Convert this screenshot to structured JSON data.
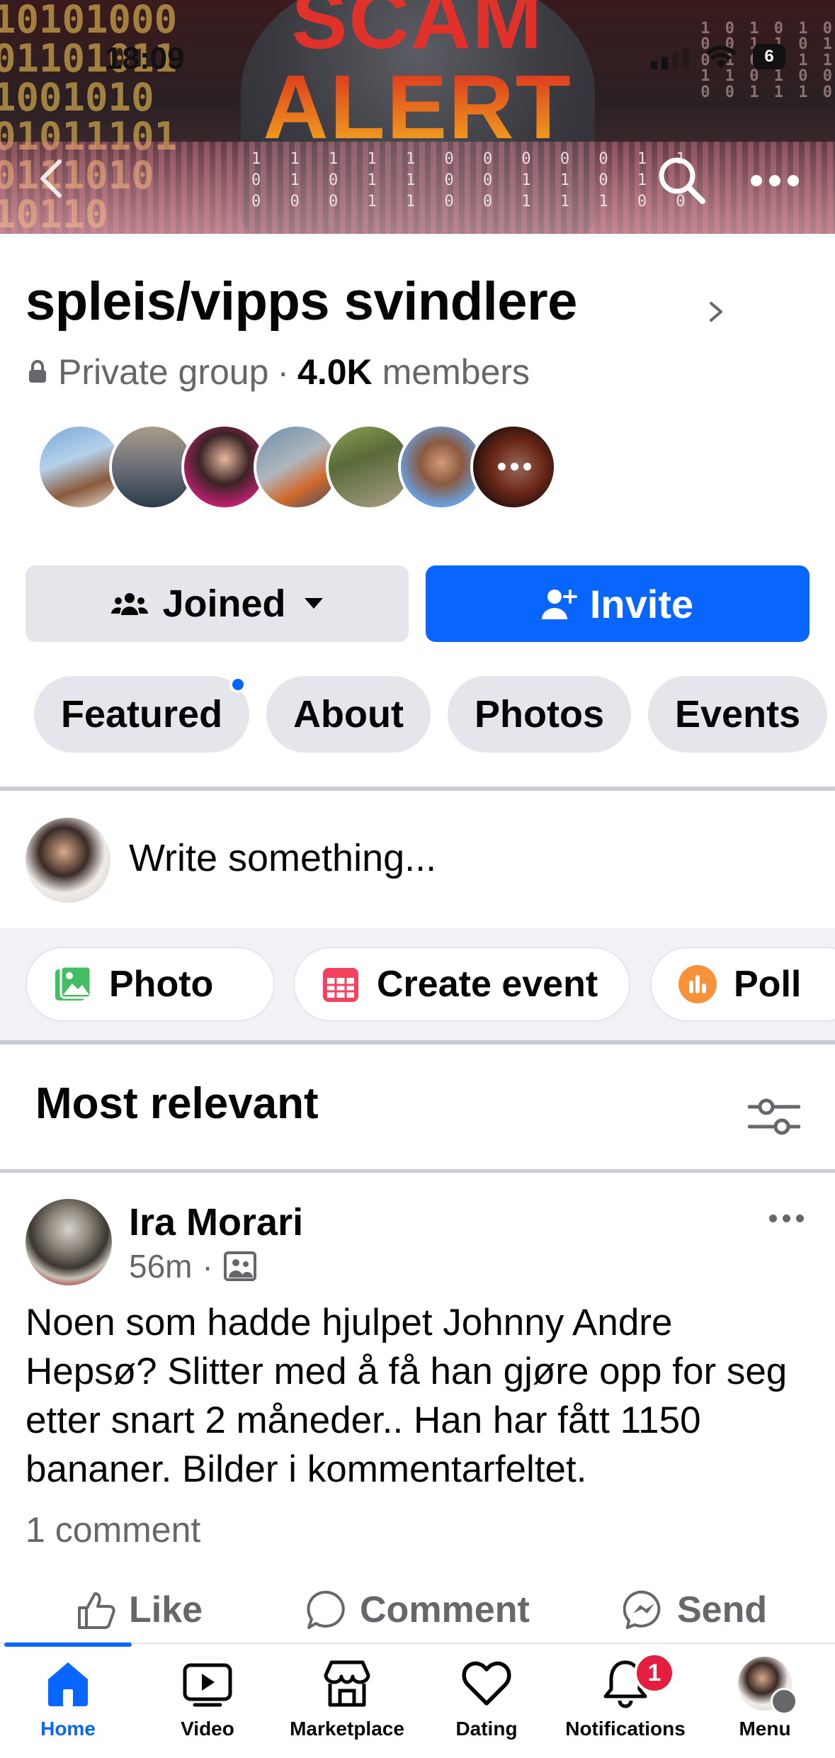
{
  "status_bar": {
    "time": "18:09",
    "battery": "6"
  },
  "cover": {
    "headline_top": "SCAM",
    "headline_bottom": "ALERT",
    "binary_left": "10101000\n01101011\n1001010\n01011101\n0111010\n10110",
    "binary_right": "1 0 1 0 1 0\n0 0 1 1 0 1\n0 1 0 0 1 1\n1 1 0 1 0 0\n0 0 1 1 1 0",
    "binary_center": "1 1 1 1 1 0 0 0 0 0 1 1\n0 1 0 1 1 0 0 1 1 0 1\n0 0 0 1 1 0 0 1 1 1 0 0"
  },
  "group": {
    "name": "spleis/vipps svindlere",
    "privacy": "Private group",
    "separator": "·",
    "members_count": "4.0K",
    "members_label": "members"
  },
  "buttons": {
    "joined": "Joined",
    "invite": "Invite"
  },
  "tabs": [
    {
      "label": "Featured",
      "has_dot": true
    },
    {
      "label": "About"
    },
    {
      "label": "Photos"
    },
    {
      "label": "Events"
    }
  ],
  "composer": {
    "placeholder": "Write something...",
    "chips": [
      {
        "label": "Photo",
        "icon": "photo-icon"
      },
      {
        "label": "Create event",
        "icon": "calendar-icon"
      },
      {
        "label": "Poll",
        "icon": "poll-icon"
      }
    ]
  },
  "feed": {
    "sort_label": "Most relevant"
  },
  "post": {
    "author": "Ira Morari",
    "time": "56m",
    "separator": "·",
    "body": "Noen som hadde hjulpet Johnny Andre Hepsø? Slitter med å få han gjøre opp for seg etter snart 2 måneder.. Han har fått 1150 bananer. Bilder i kommentarfeltet.",
    "comments": "1 comment",
    "actions": {
      "like": "Like",
      "comment": "Comment",
      "send": "Send"
    }
  },
  "nav": {
    "items": [
      {
        "label": "Home",
        "icon": "home-icon",
        "active": true
      },
      {
        "label": "Video",
        "icon": "video-icon"
      },
      {
        "label": "Marketplace",
        "icon": "marketplace-icon"
      },
      {
        "label": "Dating",
        "icon": "heart-icon"
      },
      {
        "label": "Notifications",
        "icon": "bell-icon",
        "badge": "1"
      },
      {
        "label": "Menu",
        "icon": "profile-avatar"
      }
    ]
  },
  "colors": {
    "accent": "#0866ff",
    "badge": "#e41e3f",
    "secondary_text": "#65676b",
    "chip_bg": "#e4e6eb"
  }
}
